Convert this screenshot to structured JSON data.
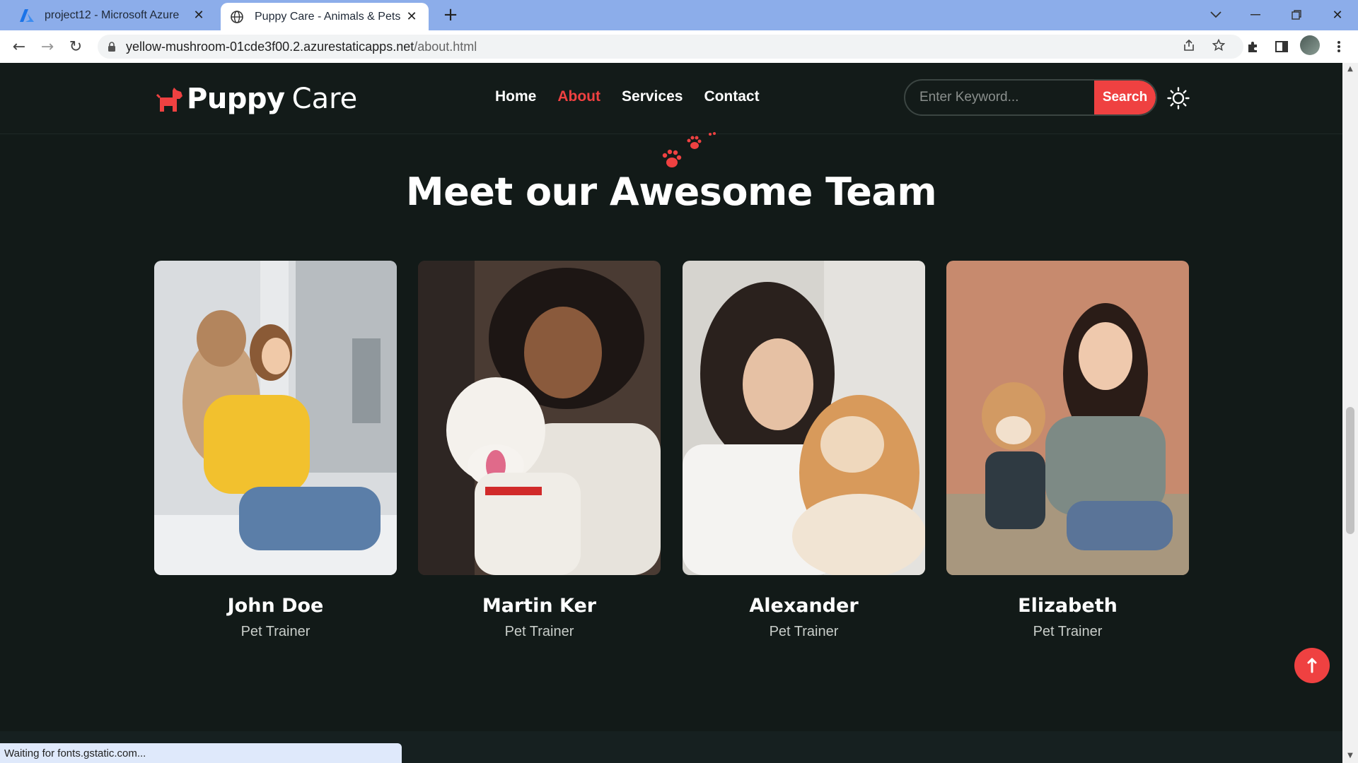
{
  "browser": {
    "tabs": [
      {
        "title": "project12 - Microsoft Azure",
        "icon": "azure-icon",
        "active": false
      },
      {
        "title": "Puppy Care - Animals & Pets Cat",
        "icon": "globe-icon",
        "active": true
      }
    ],
    "url_host": "yellow-mushroom-01cde3f00.2.azurestaticapps.net",
    "url_path": "/about.html",
    "status_text": "Waiting for fonts.gstatic.com..."
  },
  "header": {
    "brand_bold": "Puppy",
    "brand_light": "Care",
    "nav": [
      {
        "label": "Home",
        "active": false
      },
      {
        "label": "About",
        "active": true
      },
      {
        "label": "Services",
        "active": false
      },
      {
        "label": "Contact",
        "active": false
      }
    ],
    "search_placeholder": "Enter Keyword...",
    "search_label": "Search"
  },
  "team": {
    "title": "Meet our Awesome Team",
    "members": [
      {
        "name": "John Doe",
        "role": "Pet Trainer"
      },
      {
        "name": "Martin Ker",
        "role": "Pet Trainer"
      },
      {
        "name": "Alexander",
        "role": "Pet Trainer"
      },
      {
        "name": "Elizabeth",
        "role": "Pet Trainer"
      }
    ]
  },
  "colors": {
    "accent": "#ef4141",
    "background": "#121a18"
  }
}
